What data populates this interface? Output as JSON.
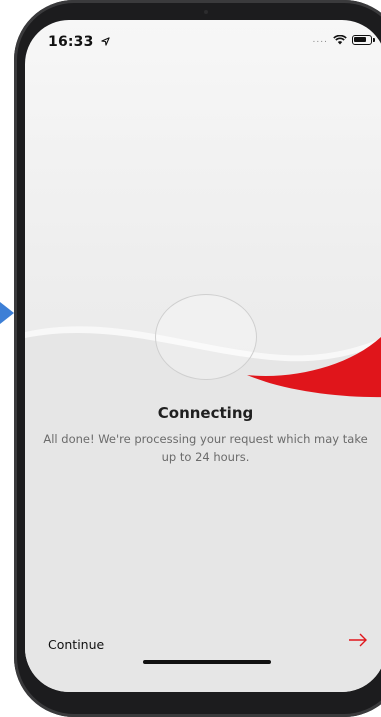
{
  "status_bar": {
    "time": "16:33",
    "location_icon": "location-arrow-icon",
    "signal": "....",
    "wifi_icon": "wifi-icon",
    "battery_level": 0.8
  },
  "connection": {
    "title": "Connecting",
    "message": "All done! We're processing your request which may take up to 24 hours."
  },
  "footer": {
    "continue_label": "Continue",
    "arrow_icon": "arrow-right-icon"
  },
  "colors": {
    "accent": "#e0151b",
    "pointer": "#3d7fd6"
  }
}
